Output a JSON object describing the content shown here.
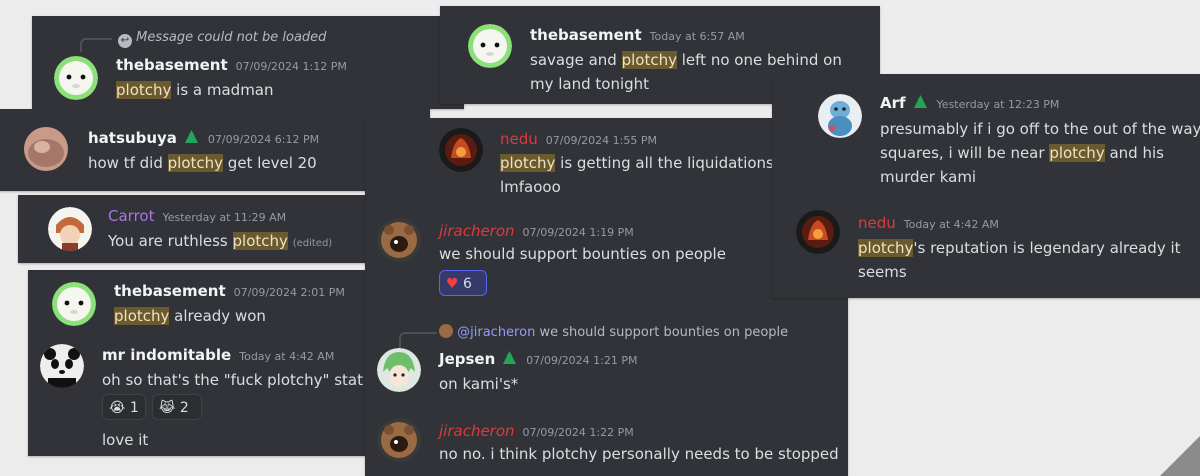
{
  "colors": {
    "card_bg": "#313338",
    "highlight": "#6b5a2d",
    "name_default": "#f2f3f5",
    "name_purple": "#a974e8",
    "name_red": "#d83c3e",
    "badge_green": "#23a559"
  },
  "cards": {
    "c1": {
      "reply_text": "Message could not be loaded",
      "author": "thebasement",
      "time": "07/09/2024 1:12 PM",
      "hl": "plotchy",
      "rest": " is a madman"
    },
    "c2": {
      "author": "hatsubuya",
      "time": "07/09/2024 6:12 PM",
      "pre": "how tf did ",
      "hl": "plotchy",
      "rest": " get level 20"
    },
    "c3": {
      "author": "Carrot",
      "time": "Yesterday at 11:29 AM",
      "pre": "You are ruthless ",
      "hl": "plotchy",
      "edited": "(edited)"
    },
    "c4": {
      "m1": {
        "author": "thebasement",
        "time": "07/09/2024 2:01 PM",
        "hl": "plotchy",
        "rest": " already won"
      },
      "m2": {
        "author": "mr indomitable",
        "time": "Today at 4:42 AM",
        "text": "oh so that's the \"fuck plotchy\" stat",
        "reactions": [
          {
            "emoji": "😭",
            "count": "1"
          },
          {
            "emoji": "😹",
            "count": "2"
          }
        ],
        "text2": "love it"
      }
    },
    "c5": {
      "author": "thebasement",
      "time": "Today at 6:57 AM",
      "pre": "savage and ",
      "hl": "plotchy",
      "rest": " left no one behind on",
      "line2": "my land tonight"
    },
    "c6": {
      "m1": {
        "author": "nedu",
        "time": "07/09/2024 1:55 PM",
        "hl": "plotchy",
        "rest": " is getting all the liquidations",
        "line2": "lmfaooo"
      },
      "m2": {
        "author": "jiracheron",
        "time": "07/09/2024 1:19 PM",
        "text": "we should support bounties on people",
        "reaction": {
          "emoji": "❤️",
          "count": "6"
        }
      },
      "m3": {
        "reply_mention": "@jiracheron",
        "reply_text": " we should support bounties on people",
        "author": "Jepsen",
        "time": "07/09/2024 1:21 PM",
        "text": "on kami's*"
      },
      "m4": {
        "author": "jiracheron",
        "time": "07/09/2024 1:22 PM",
        "text": "no no. i think plotchy personally needs to be stopped"
      }
    },
    "c7": {
      "m1": {
        "author": "Arf",
        "time": "Yesterday at 12:23 PM",
        "line1": "presumably if i go off to the out of the way",
        "pre2": "squares, i will be near ",
        "hl": "plotchy",
        "rest2": " and his",
        "line3": "murder kami"
      },
      "m2": {
        "author": "nedu",
        "time": "Today at 4:42 AM",
        "hl": "plotchy",
        "rest": "'s reputation is legendary already it",
        "line2": "seems"
      }
    }
  }
}
